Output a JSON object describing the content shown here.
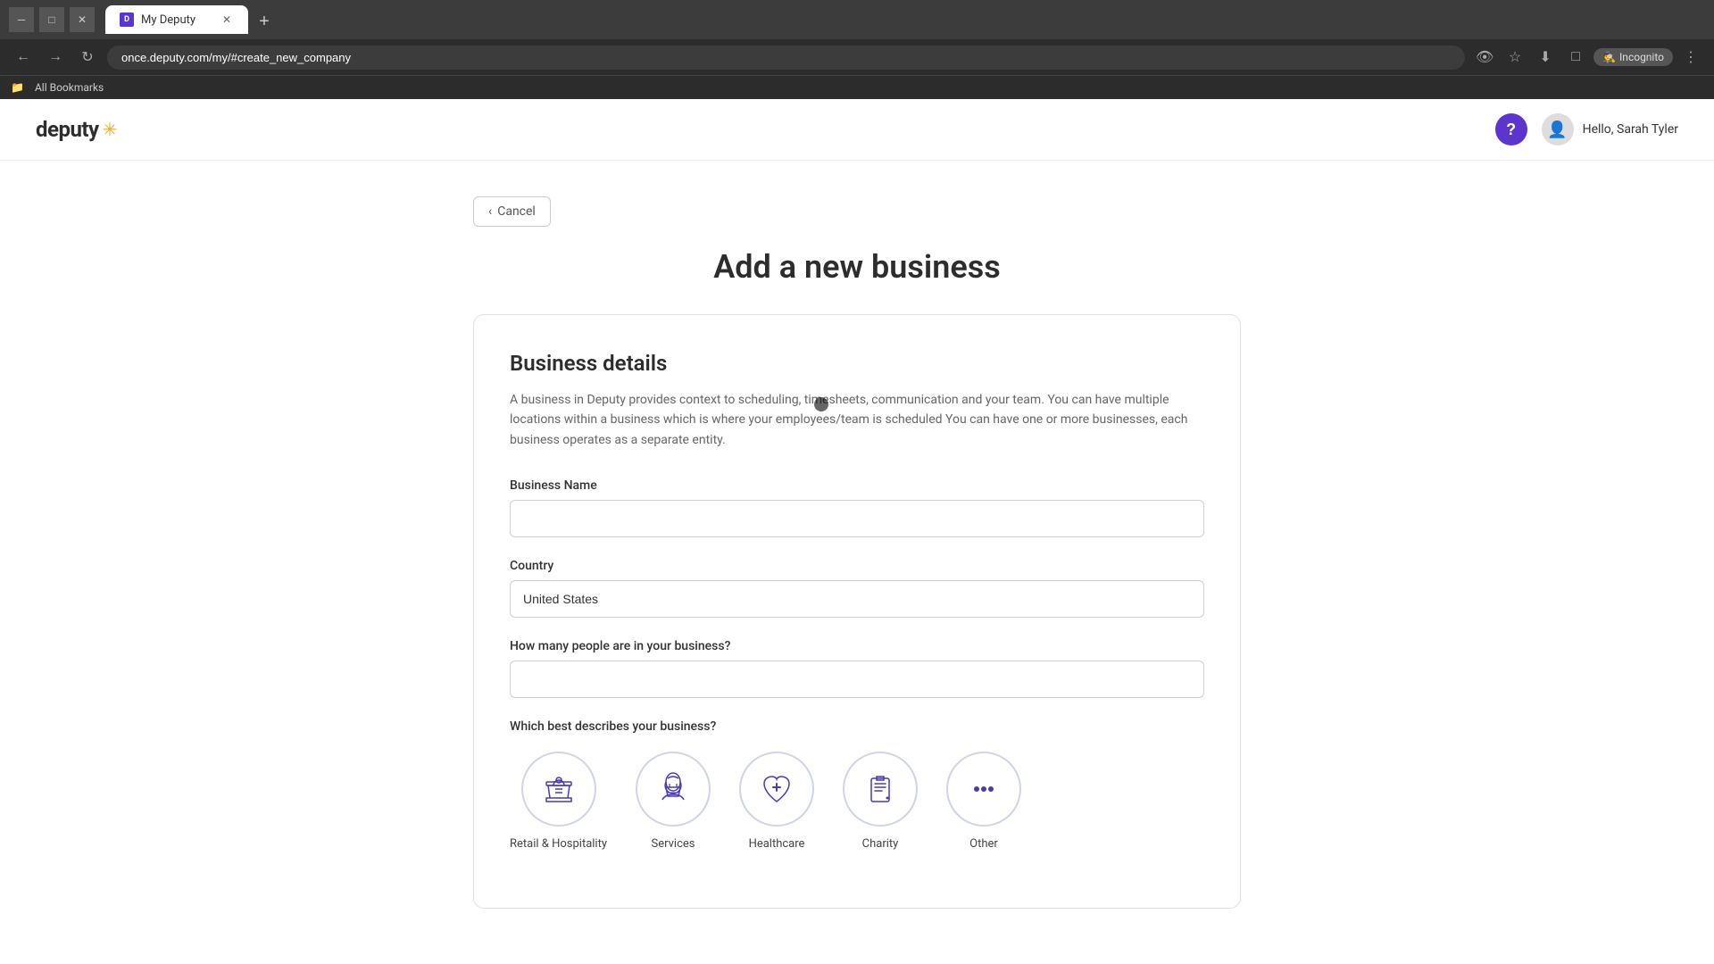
{
  "browser": {
    "tab_title": "My Deputy",
    "tab_favicon": "D",
    "address_bar": "once.deputy.com/my/#create_new_company",
    "incognito_label": "Incognito",
    "bookmarks_label": "All Bookmarks"
  },
  "header": {
    "logo_text": "deputy",
    "logo_star": "✳",
    "help_label": "?",
    "greeting": "Hello, Sarah Tyler"
  },
  "page": {
    "cancel_label": "Cancel",
    "title": "Add a new business",
    "section_title": "Business details",
    "section_description": "A business in Deputy provides context to scheduling, timesheets, communication and your team. You can have multiple locations within a business which is where your employees/team is scheduled You can have one or more businesses, each business operates as a separate entity.",
    "business_name_label": "Business Name",
    "business_name_placeholder": "",
    "country_label": "Country",
    "country_value": "United States",
    "headcount_label": "How many people are in your business?",
    "headcount_placeholder": "",
    "business_type_label": "Which best describes your business?",
    "business_types": [
      {
        "id": "retail",
        "label": "Retail & Hospitality"
      },
      {
        "id": "services",
        "label": "Services"
      },
      {
        "id": "healthcare",
        "label": "Healthcare"
      },
      {
        "id": "charity",
        "label": "Charity"
      },
      {
        "id": "other",
        "label": "Other"
      }
    ]
  }
}
